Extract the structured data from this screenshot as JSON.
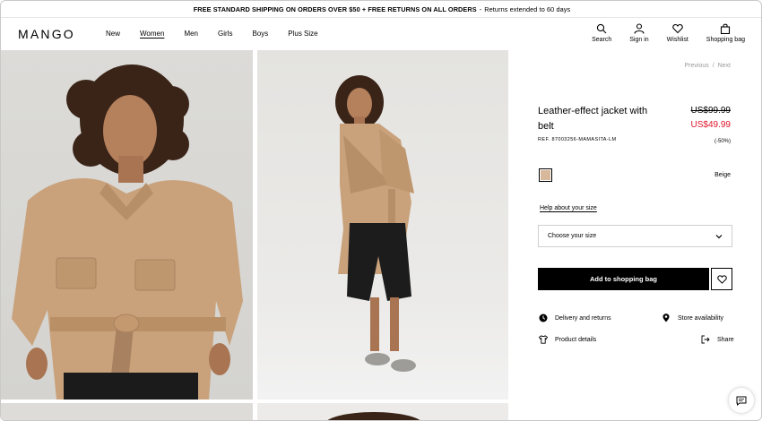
{
  "announcement": {
    "main": "FREE STANDARD SHIPPING ON ORDERS OVER $50 + FREE RETURNS ON ALL ORDERS",
    "separator": "-",
    "extra": "Returns extended to 60 days"
  },
  "header": {
    "logo": "MANGO",
    "nav": [
      "New",
      "Women",
      "Men",
      "Girls",
      "Boys",
      "Plus Size"
    ],
    "active_nav": "Women",
    "utilities": [
      {
        "label": "Search",
        "icon": "search-icon"
      },
      {
        "label": "Sign in",
        "icon": "user-icon"
      },
      {
        "label": "Wishlist",
        "icon": "heart-icon"
      },
      {
        "label": "Shopping bag",
        "icon": "bag-icon"
      }
    ]
  },
  "product": {
    "previous": "Previous",
    "divider": "/",
    "next": "Next",
    "title": "Leather-effect jacket with belt",
    "price_original": "US$99.99",
    "price_sale": "US$49.99",
    "reference": "REF. 87003256-MAMASITA-LM",
    "discount": "(-50%)",
    "color_name": "Beige",
    "size_help": "Help about your size",
    "size_placeholder": "Choose your size",
    "add_to_bag": "Add to shopping bag",
    "links": {
      "delivery": "Delivery and returns",
      "store": "Store availability",
      "details": "Product details",
      "share": "Share"
    }
  },
  "colors": {
    "sale_red": "#e0142a",
    "swatch_beige": "#d8b89a",
    "button_black": "#000000"
  }
}
